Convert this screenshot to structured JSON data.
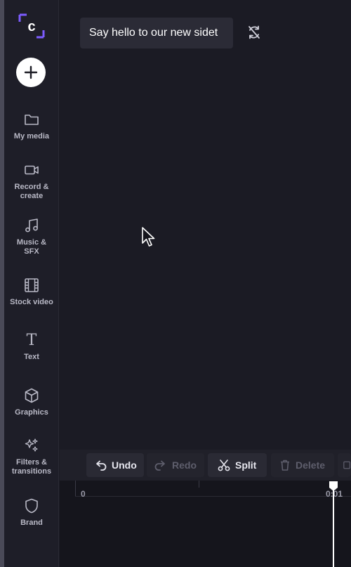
{
  "sidebar": {
    "logo_letter": "c",
    "items": [
      {
        "label": "My media",
        "icon": "folder-icon"
      },
      {
        "label": "Record &\ncreate",
        "icon": "video-camera-icon"
      },
      {
        "label": "Music &\nSFX",
        "icon": "music-note-icon"
      },
      {
        "label": "Stock video",
        "icon": "film-strip-icon"
      },
      {
        "label": "Text",
        "icon": "text-icon",
        "glyph": "T"
      },
      {
        "label": "Graphics",
        "icon": "cube-icon"
      },
      {
        "label": "Filters &\ntransitions",
        "icon": "sparkles-icon"
      },
      {
        "label": "Brand",
        "icon": "shield-icon"
      }
    ]
  },
  "main": {
    "tooltip_text": "Say hello to our new sidet"
  },
  "toolbar": {
    "undo_label": "Undo",
    "redo_label": "Redo",
    "split_label": "Split",
    "delete_label": "Delete"
  },
  "timeline": {
    "tick_start": "0",
    "tick_next": "0:01"
  },
  "colors": {
    "background": "#1b1b24",
    "sidebar": "#1e1e28",
    "accent_purple": "#7c5cff",
    "text_muted": "#b9b9c6"
  }
}
